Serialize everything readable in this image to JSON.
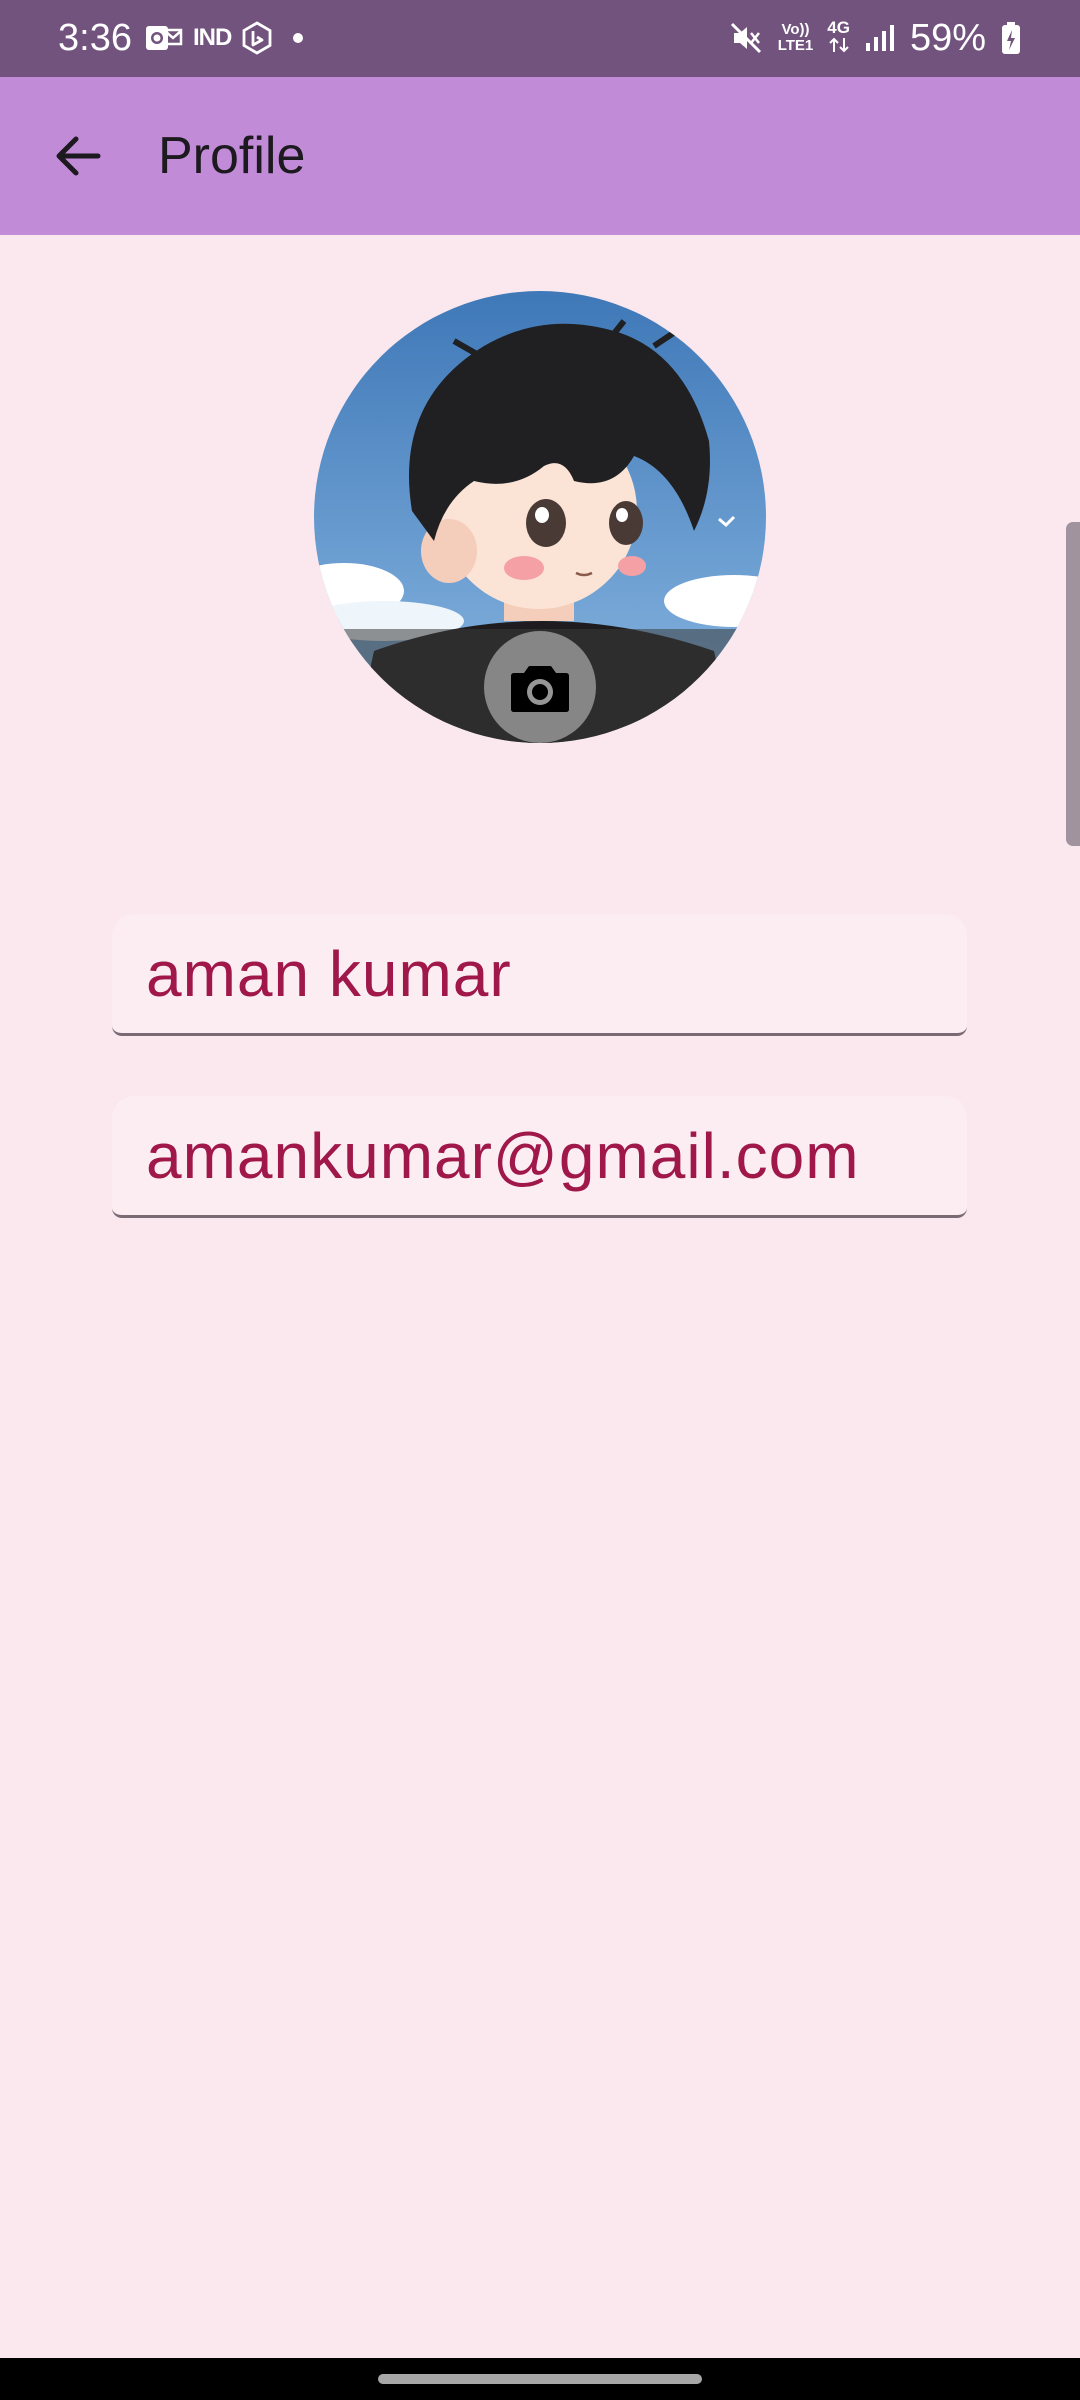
{
  "status_bar": {
    "time": "3:36",
    "network_label": "IND",
    "volte_line1": "Vo))",
    "volte_line2": "LTE1",
    "network_type": "4G",
    "battery_percent": "59%",
    "background_color": "#72537e"
  },
  "app_bar": {
    "title": "Profile",
    "back_icon": "arrow-back-icon",
    "background_color": "#c28bd8"
  },
  "avatar": {
    "description_icon": "profile-picture",
    "edit_icon": "camera-icon"
  },
  "form": {
    "name_value": "aman kumar",
    "email_value": "amankumar@gmail.com",
    "text_color": "#a0174a"
  },
  "page": {
    "background_color": "#fbe8ee"
  }
}
